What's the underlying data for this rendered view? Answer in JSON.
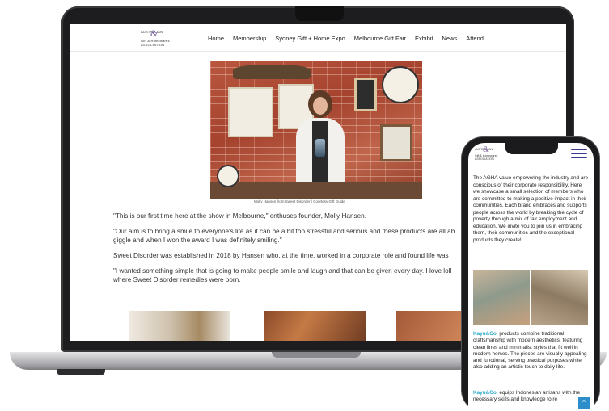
{
  "website": {
    "logo": {
      "line1": "AUSTRALIAN",
      "line2": "Gift & Homewares",
      "line3": "ASSOCIATION",
      "amp": "&"
    },
    "nav": [
      "Home",
      "Membership",
      "Sydney Gift + Home Expo",
      "Melbourne Gift Fair",
      "Exhibit",
      "News",
      "Attend"
    ],
    "hero": {
      "caption": "Molly Hansen from Sweet Disorder | Courtesy Gift Guide"
    },
    "article": {
      "paragraphs": [
        "\"This is our first time here at the show in Melbourne,\" enthuses founder, Molly Hansen.",
        "\"Our aim is to bring a smile to everyone's life as it can be a bit too stressful and serious and these products are all ab",
        "giggle and when I won the award I was definitely smiling.\"",
        "Sweet Disorder was established in 2018 by Hansen who, at the time, worked in a corporate role and found life was",
        "\"I wanted something simple that is going to make people smile and laugh and that can be given every day. I love loll",
        "where Sweet Disorder remedies were born."
      ]
    }
  },
  "phone": {
    "logo": {
      "line1": "AUSTRALIAN",
      "line2": "Gift & Homewares",
      "line3": "ASSOCIATION",
      "amp": "&"
    },
    "intro": "The AGHA value empowering the industry and are conscious of their corporate responsibility. Here we showcase a small selection of members who are committed to making a positive impact in their communities. Each brand embraces and supports people across the world by breaking the cycle of poverty through a mix of fair employment and education. We invite you to join us in embracing them, their communities and the exceptional products they create!",
    "para1": {
      "brand": "Kayu&Co.",
      "text": " products combine traditional craftsmanship with modern aesthetics, featuring clean lines and minimalist styles that fit well in modern homes. The pieces are visually appealing and functional, serving practical purposes while also adding an artistic touch to daily life."
    },
    "para2": {
      "brand": "Kayu&Co.",
      "text": " equips Indonesian artisans with the necessary skills and knowledge to re"
    },
    "scroll_top": "^"
  }
}
